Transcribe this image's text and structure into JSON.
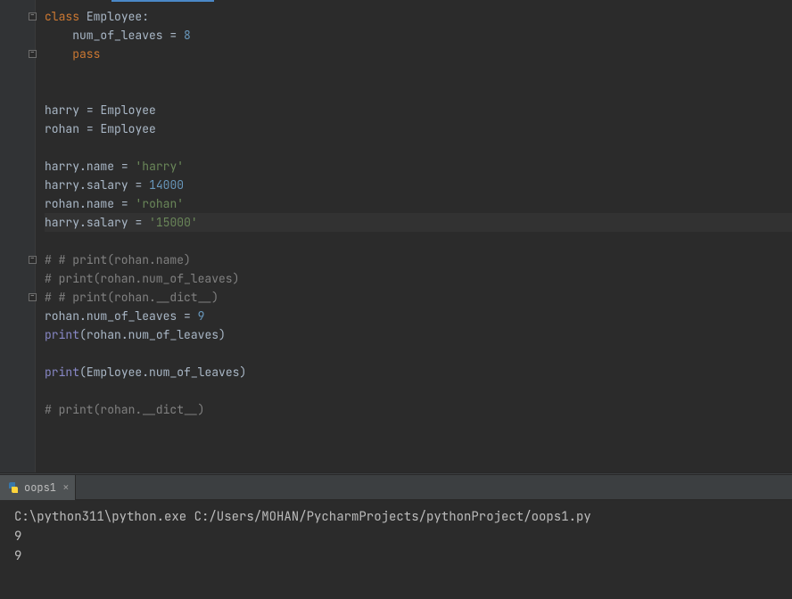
{
  "editor": {
    "lines": [
      {
        "t": [
          [
            "kw",
            "class"
          ],
          [
            "punct",
            " "
          ],
          [
            "id",
            "Employee"
          ],
          [
            "punct",
            ":"
          ]
        ],
        "fold": true
      },
      {
        "t": [
          [
            "punct",
            "    "
          ],
          [
            "id",
            "num_of_leaves"
          ],
          [
            "punct",
            " "
          ],
          [
            "op",
            "="
          ],
          [
            "punct",
            " "
          ],
          [
            "num",
            "8"
          ]
        ]
      },
      {
        "t": [
          [
            "punct",
            "    "
          ],
          [
            "kw",
            "pass"
          ]
        ],
        "fold": true
      },
      {
        "t": []
      },
      {
        "t": []
      },
      {
        "t": [
          [
            "id",
            "harry"
          ],
          [
            "punct",
            " "
          ],
          [
            "op",
            "="
          ],
          [
            "punct",
            " "
          ],
          [
            "id",
            "Employee"
          ]
        ]
      },
      {
        "t": [
          [
            "id",
            "rohan"
          ],
          [
            "punct",
            " "
          ],
          [
            "op",
            "="
          ],
          [
            "punct",
            " "
          ],
          [
            "id",
            "Employee"
          ]
        ]
      },
      {
        "t": []
      },
      {
        "t": [
          [
            "id",
            "harry"
          ],
          [
            "punct",
            "."
          ],
          [
            "id",
            "name"
          ],
          [
            "punct",
            " "
          ],
          [
            "op",
            "="
          ],
          [
            "punct",
            " "
          ],
          [
            "str",
            "'harry'"
          ]
        ]
      },
      {
        "t": [
          [
            "id",
            "harry"
          ],
          [
            "punct",
            "."
          ],
          [
            "id",
            "salary"
          ],
          [
            "punct",
            " "
          ],
          [
            "op",
            "="
          ],
          [
            "punct",
            " "
          ],
          [
            "num",
            "14000"
          ]
        ]
      },
      {
        "t": [
          [
            "id",
            "rohan"
          ],
          [
            "punct",
            "."
          ],
          [
            "id",
            "name"
          ],
          [
            "punct",
            " "
          ],
          [
            "op",
            "="
          ],
          [
            "punct",
            " "
          ],
          [
            "str",
            "'rohan'"
          ]
        ]
      },
      {
        "t": [
          [
            "id",
            "harry"
          ],
          [
            "punct",
            "."
          ],
          [
            "id",
            "salary"
          ],
          [
            "punct",
            " "
          ],
          [
            "op",
            "="
          ],
          [
            "punct",
            " "
          ],
          [
            "str",
            "'15000'"
          ]
        ],
        "highlight": true
      },
      {
        "t": []
      },
      {
        "t": [
          [
            "comment",
            "# # print(rohan.name)"
          ]
        ],
        "fold": true
      },
      {
        "t": [
          [
            "comment",
            "# print(rohan.num_of_leaves)"
          ]
        ]
      },
      {
        "t": [
          [
            "comment",
            "# # print(rohan.__dict__)"
          ]
        ],
        "fold": true
      },
      {
        "t": [
          [
            "id",
            "rohan"
          ],
          [
            "punct",
            "."
          ],
          [
            "id",
            "num_of_leaves"
          ],
          [
            "punct",
            " "
          ],
          [
            "op",
            "="
          ],
          [
            "punct",
            " "
          ],
          [
            "num",
            "9"
          ]
        ]
      },
      {
        "t": [
          [
            "builtin",
            "print"
          ],
          [
            "punct",
            "("
          ],
          [
            "id",
            "rohan"
          ],
          [
            "punct",
            "."
          ],
          [
            "id",
            "num_of_leaves"
          ],
          [
            "punct",
            ")"
          ]
        ]
      },
      {
        "t": []
      },
      {
        "t": [
          [
            "builtin",
            "print"
          ],
          [
            "punct",
            "("
          ],
          [
            "id",
            "Employee"
          ],
          [
            "punct",
            "."
          ],
          [
            "id",
            "num_of_leaves"
          ],
          [
            "punct",
            ")"
          ]
        ]
      },
      {
        "t": []
      },
      {
        "t": [
          [
            "comment",
            "# print(rohan.__dict__)"
          ]
        ]
      },
      {
        "t": []
      }
    ]
  },
  "run": {
    "tab_label": "oops1",
    "console_lines": [
      "C:\\python311\\python.exe C:/Users/MOHAN/PycharmProjects/pythonProject/oops1.py",
      "9",
      "9"
    ]
  }
}
